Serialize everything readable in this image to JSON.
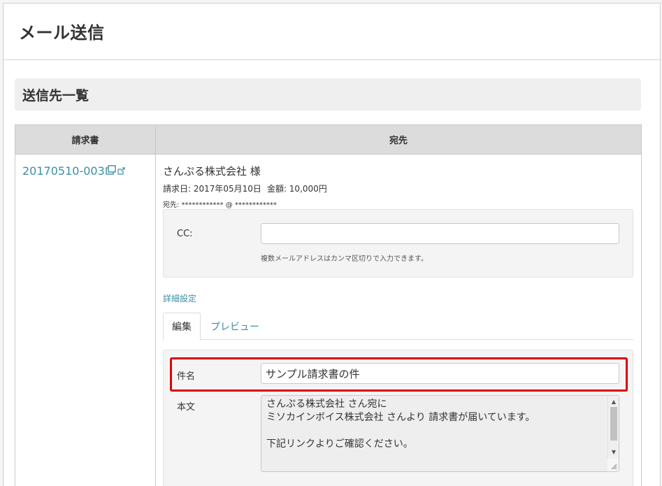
{
  "page": {
    "title": "メール送信"
  },
  "section": {
    "title": "送信先一覧"
  },
  "table": {
    "headers": {
      "invoice": "請求書",
      "recipient": "宛先"
    },
    "row": {
      "invoice_number": "20170510-003",
      "recipient_name": "さんぷる株式会社 様",
      "invoice_date": "請求日: 2017年05月10日",
      "amount": "金額: 10,000円",
      "address": "宛先:  ************ @ ************"
    }
  },
  "cc": {
    "label": "CC:",
    "value": "",
    "help": "複数メールアドレスはカンマ区切りで入力できます。"
  },
  "advanced_settings_label": "詳細設定",
  "tabs": {
    "edit": "編集",
    "preview": "プレビュー"
  },
  "mail": {
    "subject_label": "件名",
    "subject_value": "サンプル請求書の件",
    "body_label": "本文",
    "body_value": "さんぷる株式会社 さん宛に\nミソカインボイス株式会社 さんより 請求書が届いています。\n\n下記リンクよりご確認ください。"
  },
  "colors": {
    "link": "#3a8fa6",
    "highlight": "#e00000"
  },
  "icons": {
    "invoice_link": [
      "copy-icon",
      "external-link-icon"
    ]
  }
}
